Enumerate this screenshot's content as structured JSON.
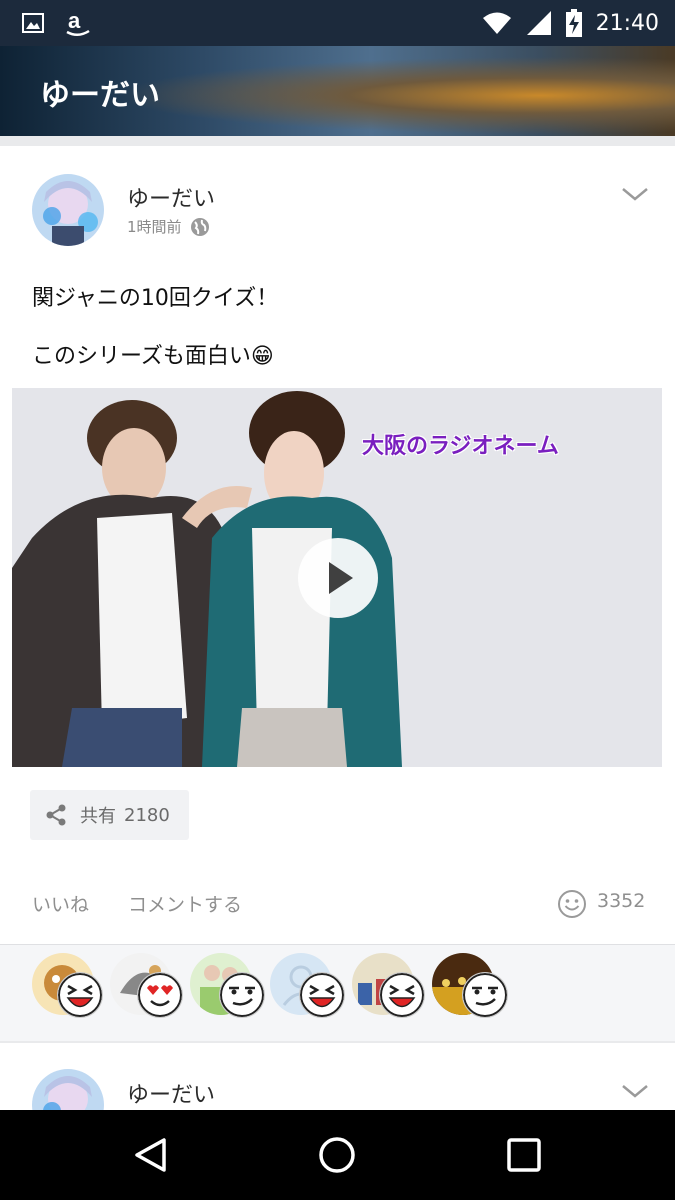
{
  "status_bar": {
    "time": "21:40",
    "icons": [
      "image-icon",
      "amazon-icon",
      "wifi-icon",
      "signal-icon",
      "battery-charging-icon"
    ]
  },
  "header": {
    "title": "ゆーだい"
  },
  "post": {
    "author": "ゆーだい",
    "timestamp": "1時間前",
    "visibility_icon": "globe-icon",
    "text_line1": "関ジャニの10回クイズ！",
    "text_line2": "このシリーズも面白い😁",
    "video": {
      "caption": "大阪のラジオネーム"
    },
    "share": {
      "label": "共有",
      "count": "2180"
    },
    "actions": {
      "like_label": "いいね",
      "comment_label": "コメントする",
      "reaction_count": "3352"
    },
    "reactions": [
      "laughing",
      "heart-eyes",
      "smirk",
      "laughing",
      "laughing",
      "smirk"
    ]
  },
  "next_post": {
    "author": "ゆーだい"
  },
  "colors": {
    "accent": "#1c2a3c",
    "caption": "#7a1fbf"
  }
}
